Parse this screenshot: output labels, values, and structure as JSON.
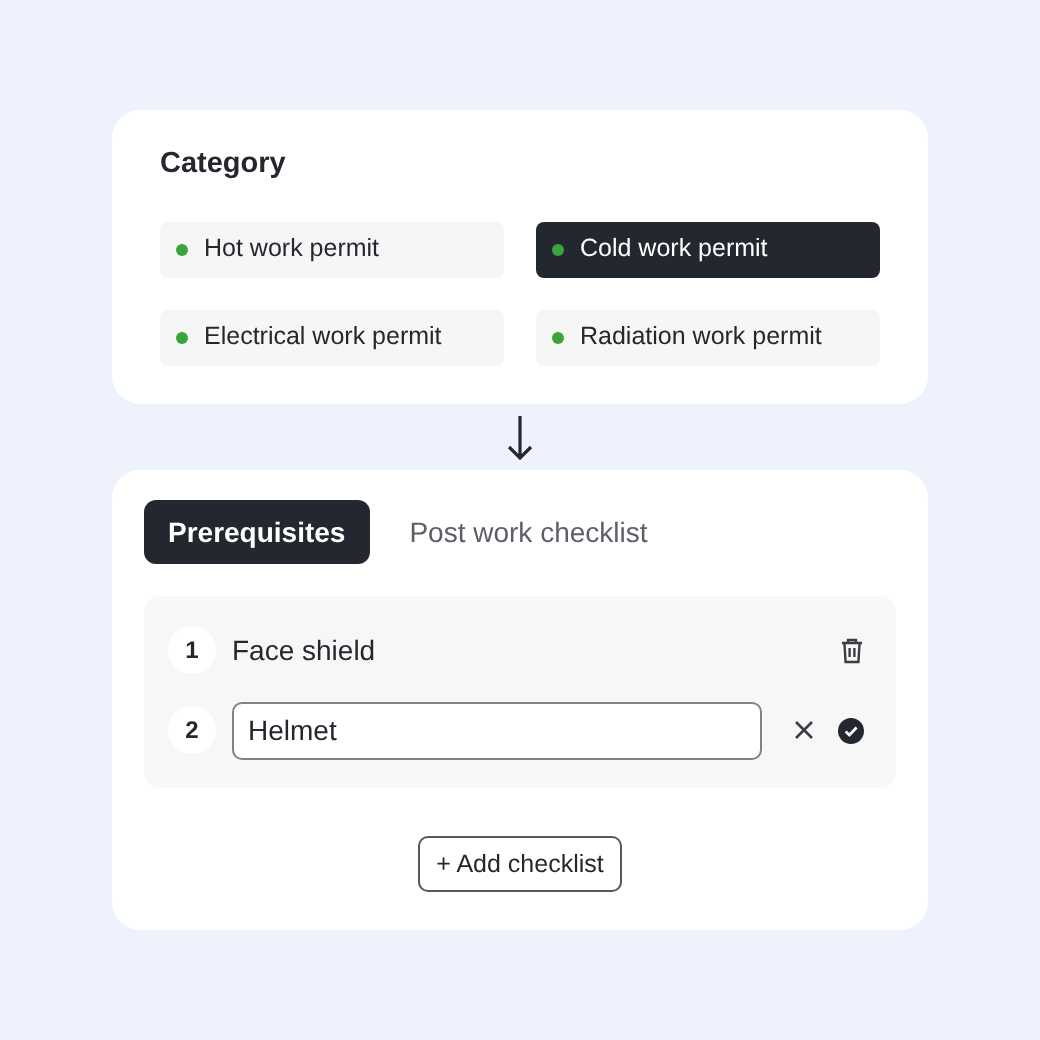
{
  "category": {
    "title": "Category",
    "options": [
      {
        "label": "Hot work permit",
        "selected": false,
        "color": "#3aa53a"
      },
      {
        "label": "Cold work permit",
        "selected": true,
        "color": "#3aa53a"
      },
      {
        "label": "Electrical work permit",
        "selected": false,
        "color": "#3aa53a"
      },
      {
        "label": "Radiation work permit",
        "selected": false,
        "color": "#3aa53a"
      }
    ]
  },
  "tabs": [
    {
      "label": "Prerequisites",
      "selected": true
    },
    {
      "label": "Post work checklist",
      "selected": false
    }
  ],
  "checklist": [
    {
      "number": "1",
      "kind": "text",
      "text": "Face shield"
    },
    {
      "number": "2",
      "kind": "editing",
      "value": "Helmet"
    }
  ],
  "add_button": "+ Add checklist"
}
